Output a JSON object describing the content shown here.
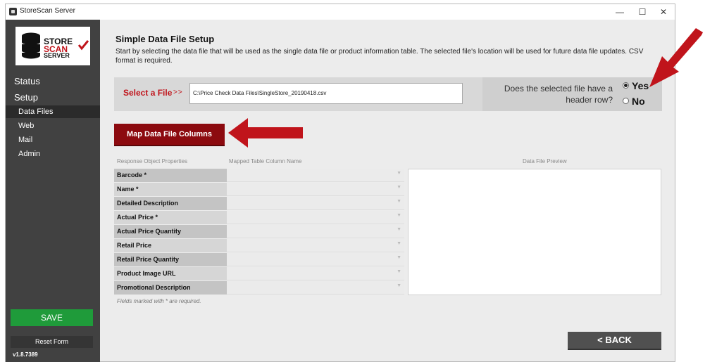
{
  "window": {
    "title": "StoreScan Server",
    "minimize": "—",
    "maximize": "☐",
    "close": "✕"
  },
  "logo": {
    "line1": "STORE",
    "line2": "SCAN",
    "line3": "SERVER"
  },
  "sidebar": {
    "status": "Status",
    "setup": "Setup",
    "items": [
      {
        "label": "Data Files"
      },
      {
        "label": "Web"
      },
      {
        "label": "Mail"
      },
      {
        "label": "Admin"
      }
    ],
    "save": "SAVE",
    "reset": "Reset Form",
    "version": "v1.8.7389"
  },
  "main": {
    "title": "Simple Data File Setup",
    "description": "Start by selecting the data file that will be used as the single data file or product information table.  The selected file's location will be used for future data file updates.  CSV format is required.",
    "select_file_label": "Select a File",
    "select_file_arrows": ">>",
    "file_path": "C:\\Price Check Data Files\\SingleStore_20190418.csv",
    "header_question_1": "Does the selected file have a",
    "header_question_2": "header row?",
    "yes": "Yes",
    "no": "No",
    "header_row_selected": "Yes",
    "map_button": "Map Data File Columns",
    "col_props": "Response Object Properties",
    "col_mapped": "Mapped Table Column Name",
    "col_preview": "Data File Preview",
    "properties": [
      "Barcode *",
      "Name *",
      "Detailed Description",
      "Actual Price *",
      "Actual Price Quantity",
      "Retail Price",
      "Retail Price Quantity",
      "Product Image URL",
      "Promotional Description"
    ],
    "required_note": "Fields marked with * are required.",
    "back": "< BACK"
  },
  "colors": {
    "accent_red": "#8c0a0f",
    "save_green": "#1f9b3a",
    "sidebar_bg": "#414141",
    "arrow_red": "#c0141b"
  }
}
